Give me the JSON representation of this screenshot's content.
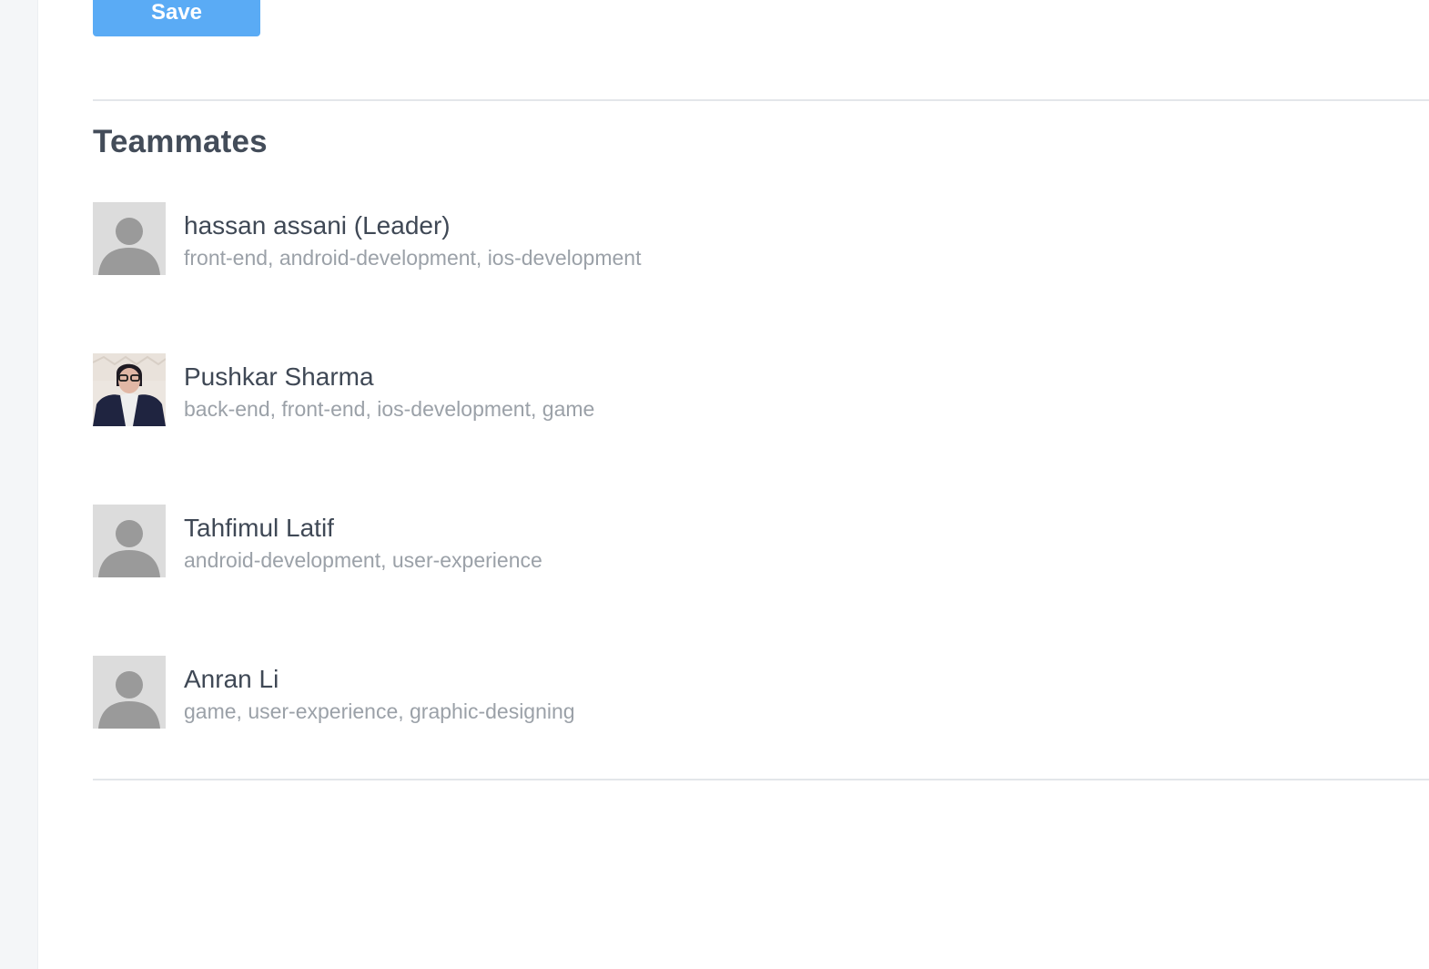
{
  "form": {
    "save_label": "Save"
  },
  "teammates": {
    "title": "Teammates",
    "members": [
      {
        "name": "hassan assani (Leader)",
        "skills": "front-end, android-development, ios-development",
        "avatar": "default-avatar-icon"
      },
      {
        "name": "Pushkar Sharma",
        "skills": "back-end, front-end, ios-development, game",
        "avatar": "profile-photo"
      },
      {
        "name": "Tahfimul Latif",
        "skills": "android-development, user-experience",
        "avatar": "default-avatar-icon"
      },
      {
        "name": "Anran Li",
        "skills": "game, user-experience, graphic-designing",
        "avatar": "default-avatar-icon"
      }
    ]
  },
  "colors": {
    "primary_button": "#5aabf5",
    "heading_text": "#434c59",
    "secondary_text": "#9ba1a8",
    "divider": "#e3e6ea",
    "side_rail": "#f4f6f8"
  }
}
